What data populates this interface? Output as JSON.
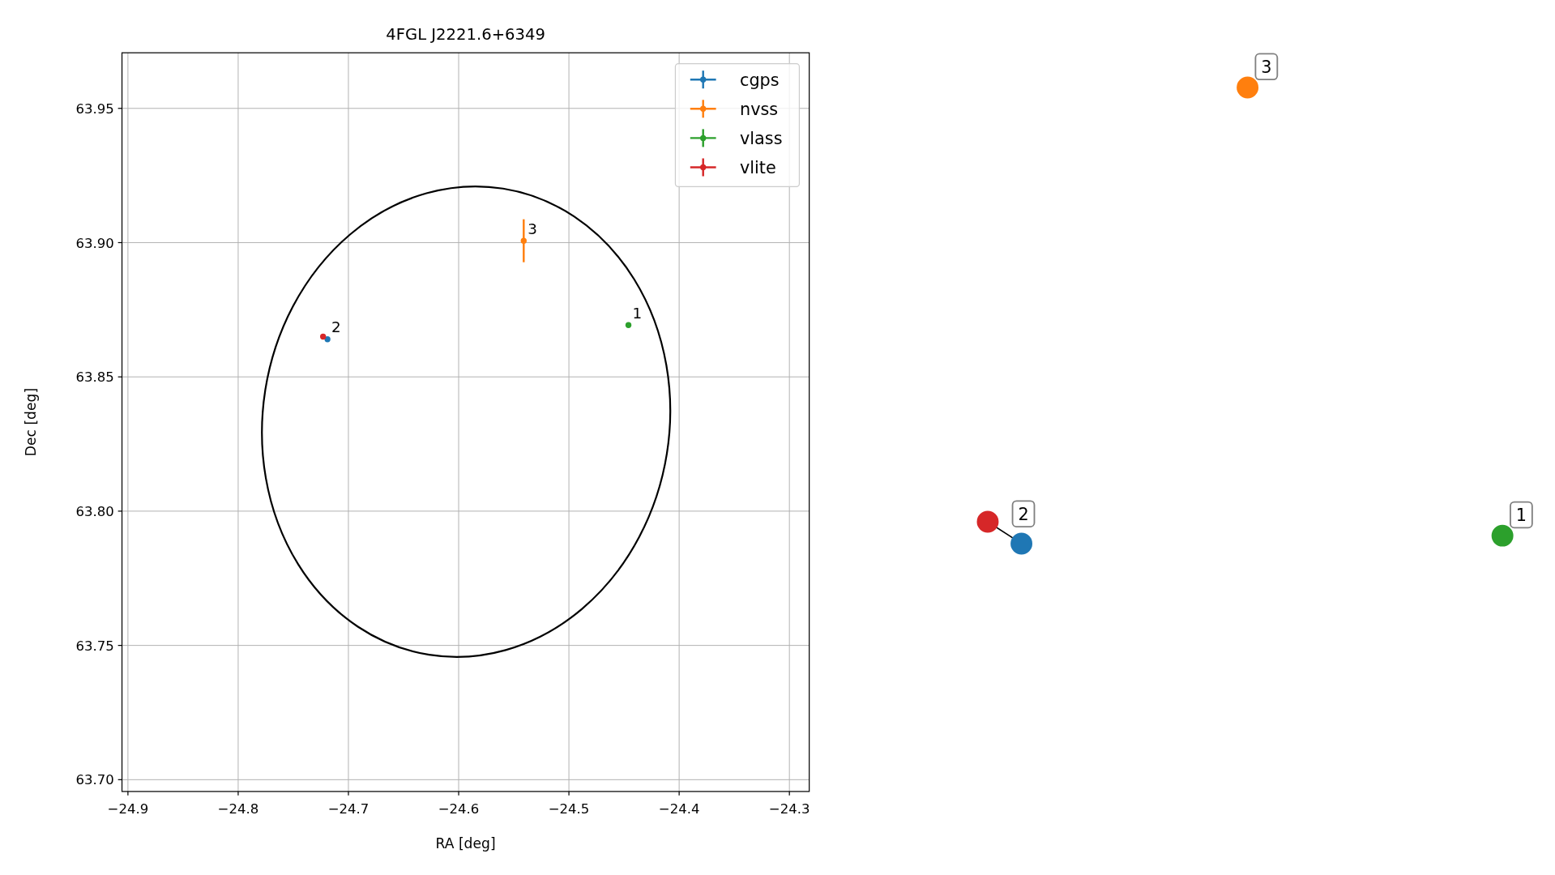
{
  "plot": {
    "chart_data": {
      "type": "scatter",
      "title": "4FGL J2221.6+6349",
      "xlabel": "RA [deg]",
      "ylabel": "Dec [deg]",
      "series": [
        {
          "name": "cgps",
          "color": "#1f77b4",
          "x": [
            -24.719
          ],
          "values": [
            63.864
          ]
        },
        {
          "name": "nvss",
          "color": "#ff7f0e",
          "x": [
            -24.541
          ],
          "values": [
            63.9007
          ]
        },
        {
          "name": "vlass",
          "color": "#2ca02c",
          "x": [
            -24.446
          ],
          "values": [
            63.8693
          ]
        },
        {
          "name": "vlite",
          "color": "#d62728",
          "x": [
            -24.723
          ],
          "values": [
            63.865
          ]
        }
      ],
      "grid": true,
      "legend": true,
      "xlim": [
        -24.9054,
        -24.282
      ],
      "ylim": [
        63.6956,
        63.9707
      ],
      "xticks": [
        {
          "value": -24.9,
          "label": "−24.9"
        },
        {
          "value": -24.8,
          "label": "−24.8"
        },
        {
          "value": -24.7,
          "label": "−24.7"
        },
        {
          "value": -24.6,
          "label": "−24.6"
        },
        {
          "value": -24.5,
          "label": "−24.5"
        },
        {
          "value": -24.4,
          "label": "−24.4"
        },
        {
          "value": -24.3,
          "label": "−24.3"
        }
      ],
      "yticks": [
        {
          "value": 63.7,
          "label": "63.70"
        },
        {
          "value": 63.75,
          "label": "63.75"
        },
        {
          "value": 63.8,
          "label": "63.80"
        },
        {
          "value": 63.85,
          "label": "63.85"
        },
        {
          "value": 63.9,
          "label": "63.90"
        },
        {
          "value": 63.95,
          "label": "63.95"
        }
      ],
      "annotations": [
        {
          "text": "1",
          "x": -24.446,
          "y": 63.8693
        },
        {
          "text": "2",
          "x": -24.719,
          "y": 63.864
        },
        {
          "text": "3",
          "x": -24.541,
          "y": 63.9007
        }
      ]
    }
  },
  "graph": {
    "nodes": [
      {
        "color": "#d62728"
      },
      {
        "color": "#1f77b4",
        "label": "2"
      },
      {
        "color": "#ff7f0e",
        "label": "3"
      },
      {
        "color": "#2ca02c",
        "label": "1"
      }
    ]
  }
}
